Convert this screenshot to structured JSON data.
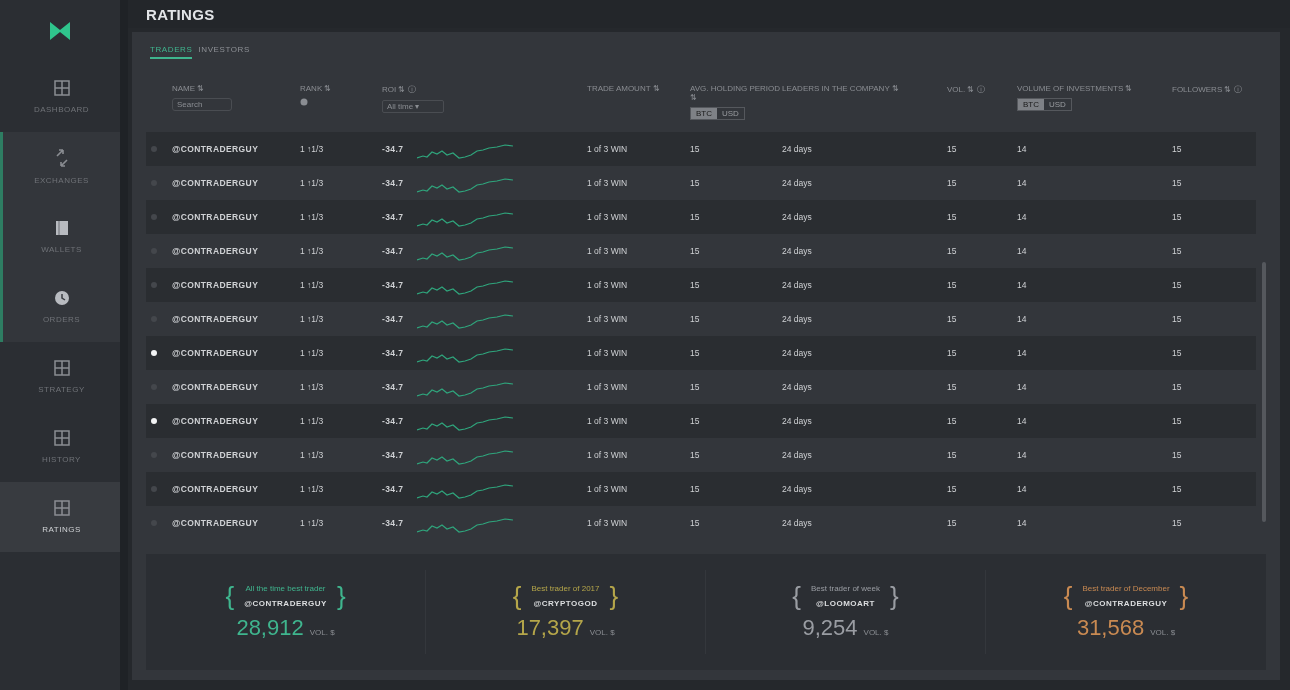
{
  "sidebar": {
    "items": [
      {
        "label": "DASHBOARD",
        "selected": false,
        "highlighted": false
      },
      {
        "label": "EXCHANGES",
        "selected": false,
        "highlighted": true
      },
      {
        "label": "WALLETS",
        "selected": false,
        "highlighted": true
      },
      {
        "label": "ORDERS",
        "selected": false,
        "highlighted": true
      },
      {
        "label": "STRATEGY",
        "selected": false,
        "highlighted": false
      },
      {
        "label": "HISTORY",
        "selected": false,
        "highlighted": false
      },
      {
        "label": "RATINGS",
        "selected": true,
        "highlighted": false
      }
    ]
  },
  "header": {
    "title": "RATINGS"
  },
  "tabs": [
    {
      "label": "TRADERS",
      "selected": true
    },
    {
      "label": "INVESTORS",
      "selected": false
    }
  ],
  "table": {
    "columns": [
      {
        "label": "NAME ⇅",
        "filter": {
          "kind": "search",
          "placeholder": "Search"
        }
      },
      {
        "label": "RANK ⇅",
        "filter": {
          "kind": "icon"
        }
      },
      {
        "label": "ROI ⇅ ⓘ",
        "filter": {
          "kind": "dropdown",
          "value": "All time ▾"
        }
      },
      {
        "label": "TRADE AMOUNT ⇅"
      },
      {
        "label": "AVG. HOLDING PERIOD ⇅",
        "filter": {
          "kind": "toggle",
          "options": [
            {
              "label": "BTC",
              "selected": true
            },
            {
              "label": "USD",
              "selected": false
            }
          ]
        }
      },
      {
        "label": "LEADERS IN THE COMPANY ⇅"
      },
      {
        "label": "VOL. ⇅ ⓘ"
      },
      {
        "label": "VOLUME OF INVESTMENTS ⇅",
        "filter": {
          "kind": "toggle",
          "options": [
            {
              "label": "BTC",
              "selected": true
            },
            {
              "label": "USD",
              "selected": false
            }
          ]
        }
      },
      {
        "label": "FOLLOWERS ⇅ ⓘ"
      }
    ],
    "rows": [
      {
        "selected": false,
        "cells": [
          "@CONTRADERGUY",
          "1 ↑1/3",
          "-34.7",
          "1 of 3 WIN",
          "15",
          "24 days",
          "15",
          "14",
          "15"
        ]
      },
      {
        "selected": false,
        "cells": [
          "@CONTRADERGUY",
          "1 ↑1/3",
          "-34.7",
          "1 of 3 WIN",
          "15",
          "24 days",
          "15",
          "14",
          "15"
        ]
      },
      {
        "selected": false,
        "cells": [
          "@CONTRADERGUY",
          "1 ↑1/3",
          "-34.7",
          "1 of 3 WIN",
          "15",
          "24 days",
          "15",
          "14",
          "15"
        ]
      },
      {
        "selected": false,
        "cells": [
          "@CONTRADERGUY",
          "1 ↑1/3",
          "-34.7",
          "1 of 3 WIN",
          "15",
          "24 days",
          "15",
          "14",
          "15"
        ]
      },
      {
        "selected": false,
        "cells": [
          "@CONTRADERGUY",
          "1 ↑1/3",
          "-34.7",
          "1 of 3 WIN",
          "15",
          "24 days",
          "15",
          "14",
          "15"
        ]
      },
      {
        "selected": false,
        "cells": [
          "@CONTRADERGUY",
          "1 ↑1/3",
          "-34.7",
          "1 of 3 WIN",
          "15",
          "24 days",
          "15",
          "14",
          "15"
        ]
      },
      {
        "selected": true,
        "cells": [
          "@CONTRADERGUY",
          "1 ↑1/3",
          "-34.7",
          "1 of 3 WIN",
          "15",
          "24 days",
          "15",
          "14",
          "15"
        ]
      },
      {
        "selected": false,
        "cells": [
          "@CONTRADERGUY",
          "1 ↑1/3",
          "-34.7",
          "1 of 3 WIN",
          "15",
          "24 days",
          "15",
          "14",
          "15"
        ]
      },
      {
        "selected": true,
        "cells": [
          "@CONTRADERGUY",
          "1 ↑1/3",
          "-34.7",
          "1 of 3 WIN",
          "15",
          "24 days",
          "15",
          "14",
          "15"
        ]
      },
      {
        "selected": false,
        "cells": [
          "@CONTRADERGUY",
          "1 ↑1/3",
          "-34.7",
          "1 of 3 WIN",
          "15",
          "24 days",
          "15",
          "14",
          "15"
        ]
      },
      {
        "selected": false,
        "cells": [
          "@CONTRADERGUY",
          "1 ↑1/3",
          "-34.7",
          "1 of 3 WIN",
          "15",
          "24 days",
          "15",
          "14",
          "15"
        ]
      },
      {
        "selected": false,
        "cells": [
          "@CONTRADERGUY",
          "1 ↑1/3",
          "-34.7",
          "1 of 3 WIN",
          "15",
          "24 days",
          "15",
          "14",
          "15"
        ]
      }
    ]
  },
  "highlights": [
    {
      "open_brace": "{",
      "caption": "All the time best trader",
      "name": "@CONTRADERGUY",
      "close_brace": "}",
      "value": "28,912",
      "unit": "VOL. $",
      "color": "#3fb58e"
    },
    {
      "open_brace": "{",
      "caption": "Best trader of 2017",
      "name": "@CRYPTOGOD",
      "close_brace": "}",
      "value": "17,397",
      "unit": "VOL. $",
      "color": "#b5a64a"
    },
    {
      "open_brace": "{",
      "caption": "Best trader of week",
      "name": "@LOOMOART",
      "close_brace": "}",
      "value": "9,254",
      "unit": "VOL. $",
      "color": "#9a9da3"
    },
    {
      "open_brace": "{",
      "caption": "Best trader of December",
      "name": "@CONTRADERGUY",
      "close_brace": "}",
      "value": "31,568",
      "unit": "VOL. $",
      "color": "#c98a52"
    }
  ]
}
